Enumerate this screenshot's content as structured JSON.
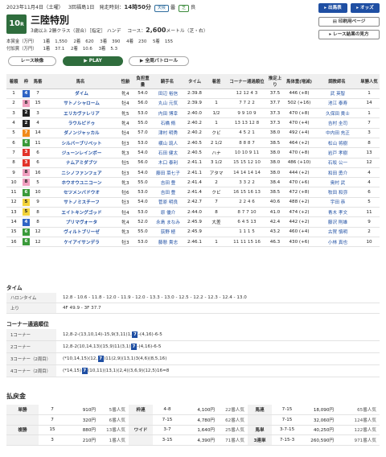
{
  "header": {
    "date": "2023年11月4日（土曜）",
    "meeting": "3回福島1日",
    "start_label": "発走時刻：",
    "start_time": "14時50分",
    "weather": "天候",
    "weather_val": "曇",
    "track": "芝",
    "track_val": "良",
    "race_no": "10",
    "race_no_suffix": "R",
    "race_name": "三陸特別",
    "conditions": "3歳以上 2勝クラス（混合）［指定］ ハンデ",
    "course_label": "コース：",
    "distance": "2,600",
    "course_unit": "メートル（芝・右）"
  },
  "buttons": {
    "results": "出馬表",
    "odds": "オッズ",
    "print": "印刷用ページ",
    "guide": "レース結果の見方",
    "replay": "レース映像",
    "play": "PLAY",
    "patrol": "全周パトロール"
  },
  "prize": {
    "row1": [
      "本賞金（万円）",
      "1着",
      "1,550",
      "2着",
      "620",
      "3着",
      "390",
      "4着",
      "230",
      "5着",
      "155"
    ],
    "row2": [
      "付加賞（万円）",
      "1着",
      "37.1",
      "2着",
      "10.6",
      "3着",
      "5.3"
    ]
  },
  "table": {
    "headers": [
      "着順",
      "枠",
      "馬番",
      "馬名",
      "性齢",
      "負担重量",
      "騎手名",
      "タイム",
      "着差",
      "コーナー通過順位",
      "推定上り",
      "馬体重(増減)",
      "調教師名",
      "単勝人気"
    ],
    "rows": [
      [
        "1",
        "4",
        "7",
        "ダイム",
        "牝4",
        "54.0",
        "田辺 裕信",
        "2:39.8",
        "",
        "12 12 4 3",
        "37.5",
        "446 (+8)",
        "武 英智",
        "1"
      ],
      [
        "2",
        "8",
        "15",
        "サトノシャローム",
        "牡4",
        "56.0",
        "丸山 元気",
        "2:39.9",
        "1",
        "7 7 2 2",
        "37.7",
        "502 (+16)",
        "池江 泰寿",
        "14"
      ],
      [
        "3",
        "2",
        "3",
        "エリカヴァレリア",
        "牝5",
        "53.0",
        "内田 博幸",
        "2:40.0",
        "1/2",
        "9 9 10 9",
        "37.3",
        "470 (+8)",
        "久保田 貴士",
        "1"
      ],
      [
        "4",
        "2",
        "4",
        "ラウルピドゥ",
        "牝4",
        "55.0",
        "石橋 脩",
        "2:40.2",
        "1",
        "13 13 12 8",
        "37.3",
        "470 (+4)",
        "吉村 圭司",
        "7"
      ],
      [
        "5",
        "7",
        "14",
        "ダノンジャッカル",
        "牡4",
        "57.0",
        "津村 明秀",
        "2:40.2",
        "クビ",
        "4 5 2 1",
        "38.0",
        "492 (+4)",
        "中内田 充正",
        "3"
      ],
      [
        "6",
        "6",
        "11",
        "シルバーブリベット",
        "牡3",
        "53.0",
        "横山 琉人",
        "2:40.5",
        "2 1/2",
        "8 8 8 7",
        "38.5",
        "464 (+2)",
        "松山 将樹",
        "8"
      ],
      [
        "7",
        "3",
        "6",
        "ジューンレインボー",
        "牝3",
        "54.0",
        "石田 健太",
        "2:40.5",
        "ハナ",
        "10 10 9 11",
        "38.0",
        "470 (+8)",
        "岩戸 孝樹",
        "13"
      ],
      [
        "8",
        "3",
        "6",
        "ナムアミダブツ",
        "牡5",
        "56.0",
        "木口 泰利",
        "2:41.1",
        "3 1/2",
        "15 15 12 10",
        "38.0",
        "486 (+10)",
        "石坂 公一",
        "12"
      ],
      [
        "9",
        "8",
        "16",
        "ニシノファンフェア",
        "牡3",
        "54.0",
        "藤田 菜七子",
        "2:41.1",
        "アタマ",
        "14 14 14 14",
        "38.0",
        "444 (+2)",
        "和田 勇介",
        "4"
      ],
      [
        "10",
        "8",
        "5",
        "ホウオウユニコーン",
        "牝3",
        "55.0",
        "吉田 豊",
        "2:41.4",
        "2",
        "3 3 2 2",
        "38.4",
        "470 (+6)",
        "奥村 武",
        "4"
      ],
      [
        "11",
        "6",
        "10",
        "セツメンバドウオ",
        "牡6",
        "53.0",
        "吉田 豊",
        "2:41.4",
        "クビ",
        "16 15 16 13",
        "38.5",
        "472 (+8)",
        "牧田 和弥",
        "6"
      ],
      [
        "12",
        "5",
        "9",
        "サトノミスチーフ",
        "牡3",
        "54.0",
        "菅原 明良",
        "2:42.7",
        "7",
        "2 2 4 6",
        "40.6",
        "488 (+2)",
        "宇田 恭",
        "5"
      ],
      [
        "13",
        "5",
        "8",
        "エイトキングゴッド",
        "牡4",
        "53.0",
        "原 優介",
        "2:44.0",
        "8",
        "8 7 7 10",
        "41.0",
        "474 (+2)",
        "青木 孝文",
        "11"
      ],
      [
        "14",
        "4",
        "8",
        "プリマヴォータ",
        "牝4",
        "52.0",
        "永島 まなみ",
        "2:45.9",
        "大差",
        "6 4 5 13",
        "42.4",
        "442 (+2)",
        "藤沢 則雄",
        "9"
      ],
      [
        "15",
        "6",
        "12",
        "ヴィルトブリーゼ",
        "牝3",
        "55.0",
        "荻野 極",
        "2:45.9",
        "",
        "1 1 1 5",
        "43.2",
        "460 (+4)",
        "古賀 慎明",
        "2"
      ],
      [
        "16",
        "6",
        "12",
        "ケイアイサンデラ",
        "牡3",
        "53.0",
        "藤懸 貴志",
        "2:46.1",
        "1",
        "11 11 15 16",
        "46.3",
        "430 (+6)",
        "小林 真也",
        "10"
      ]
    ]
  },
  "waku_colors": {
    "1": "#ffffff",
    "2": "#222222",
    "3": "#e2332a",
    "4": "#2f64c4",
    "5": "#f2d33c",
    "6": "#3a9a3a",
    "7": "#f08a1a",
    "8": "#f0a0c0"
  },
  "lap": {
    "title": "タイム",
    "halon_label": "ハロンタイム",
    "halon": "12.8 - 10.6 - 11.8 - 12.0 - 11.9 - 12.0 - 13.3 - 13.0 - 12.5 - 12.2 - 12.3 - 12.4 - 13.0",
    "agari_label": "上り",
    "agari": "4F 49.9 - 3F 37.7"
  },
  "corner": {
    "title": "コーナー通過順位",
    "rows": [
      {
        "label": "1コーナー",
        "pre": "12,8-2-(13,10,14)-15,9(3,11)1,",
        "hl": "7",
        "post": "-(4,16)-6-5"
      },
      {
        "label": "2コーナー",
        "pre": "12,8-2(10,14,13)(15,9)11(3,1)",
        "hl": "7",
        "post": "-(4,16)-6-5"
      },
      {
        "label": "3コーナー（2周目）",
        "pre": "(*10,14,15)(12,",
        "hl": "7",
        "post": ")11(2,9)(13,1)3(4,6)(8,5,16)"
      },
      {
        "label": "4コーナー（2周目）",
        "pre": "(*14,15)",
        "hl": "7",
        "post": "(10,11)(13,1)(2,4)(3,6,9)(12,5)16=8"
      }
    ]
  },
  "payout": {
    "title": "払戻金",
    "rows": [
      [
        "単勝",
        "7",
        "910円",
        "5番人気",
        "枠連",
        "4-8",
        "4,100円",
        "22番人気",
        "馬連",
        "7-15",
        "18,090円",
        "65番人気"
      ],
      [
        "",
        "7",
        "320円",
        "6番人気",
        "",
        "7-15",
        "4,780円",
        "62番人気",
        "",
        "7-15",
        "32,060円",
        "124番人気"
      ],
      [
        "複勝",
        "15",
        "880円",
        "13番人気",
        "ワイド",
        "3-7",
        "1,640円",
        "25番人気",
        "馬単",
        "3-7-15",
        "40,250円",
        "122番人気"
      ],
      [
        "",
        "3",
        "210円",
        "1番人気",
        "",
        "3-15",
        "4,390円",
        "71番人気",
        "3連単",
        "7-15-3",
        "260,590円",
        "971番人気"
      ]
    ]
  }
}
